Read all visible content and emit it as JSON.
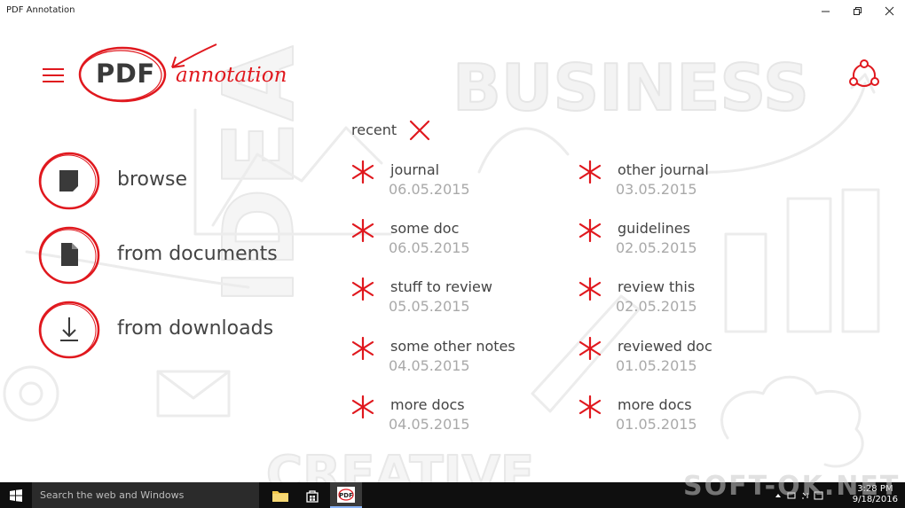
{
  "window": {
    "title": "PDF Annotation",
    "controls": [
      "minimize",
      "maximize",
      "close"
    ]
  },
  "header": {
    "logo_main": "PDF",
    "logo_script": "annotation",
    "menu_icon": "hamburger-icon",
    "share_icon": "share-icon"
  },
  "nav": [
    {
      "label": "browse",
      "icon": "folder-icon"
    },
    {
      "label": "from documents",
      "icon": "document-icon"
    },
    {
      "label": "from downloads",
      "icon": "download-icon"
    }
  ],
  "recent": {
    "label": "recent",
    "clear_icon": "close-icon",
    "items": [
      {
        "name": "journal",
        "date": "06.05.2015"
      },
      {
        "name": "some doc",
        "date": "06.05.2015"
      },
      {
        "name": "stuff to review",
        "date": "05.05.2015"
      },
      {
        "name": "some other notes",
        "date": "04.05.2015"
      },
      {
        "name": "more docs",
        "date": "04.05.2015"
      },
      {
        "name": "other journal",
        "date": "03.05.2015"
      },
      {
        "name": "guidelines",
        "date": "02.05.2015"
      },
      {
        "name": "review this",
        "date": "02.05.2015"
      },
      {
        "name": "reviewed doc",
        "date": "01.05.2015"
      },
      {
        "name": "more docs",
        "date": "01.05.2015"
      }
    ]
  },
  "taskbar": {
    "search_placeholder": "Search the web and Windows",
    "time": "3:28 PM",
    "date": "9/18/2016",
    "watermark": "SOFT-OK.NET"
  },
  "colors": {
    "accent": "#e0181e",
    "text": "#444444",
    "muted": "#a9a9a9",
    "taskbar": "#0f0f0f"
  }
}
